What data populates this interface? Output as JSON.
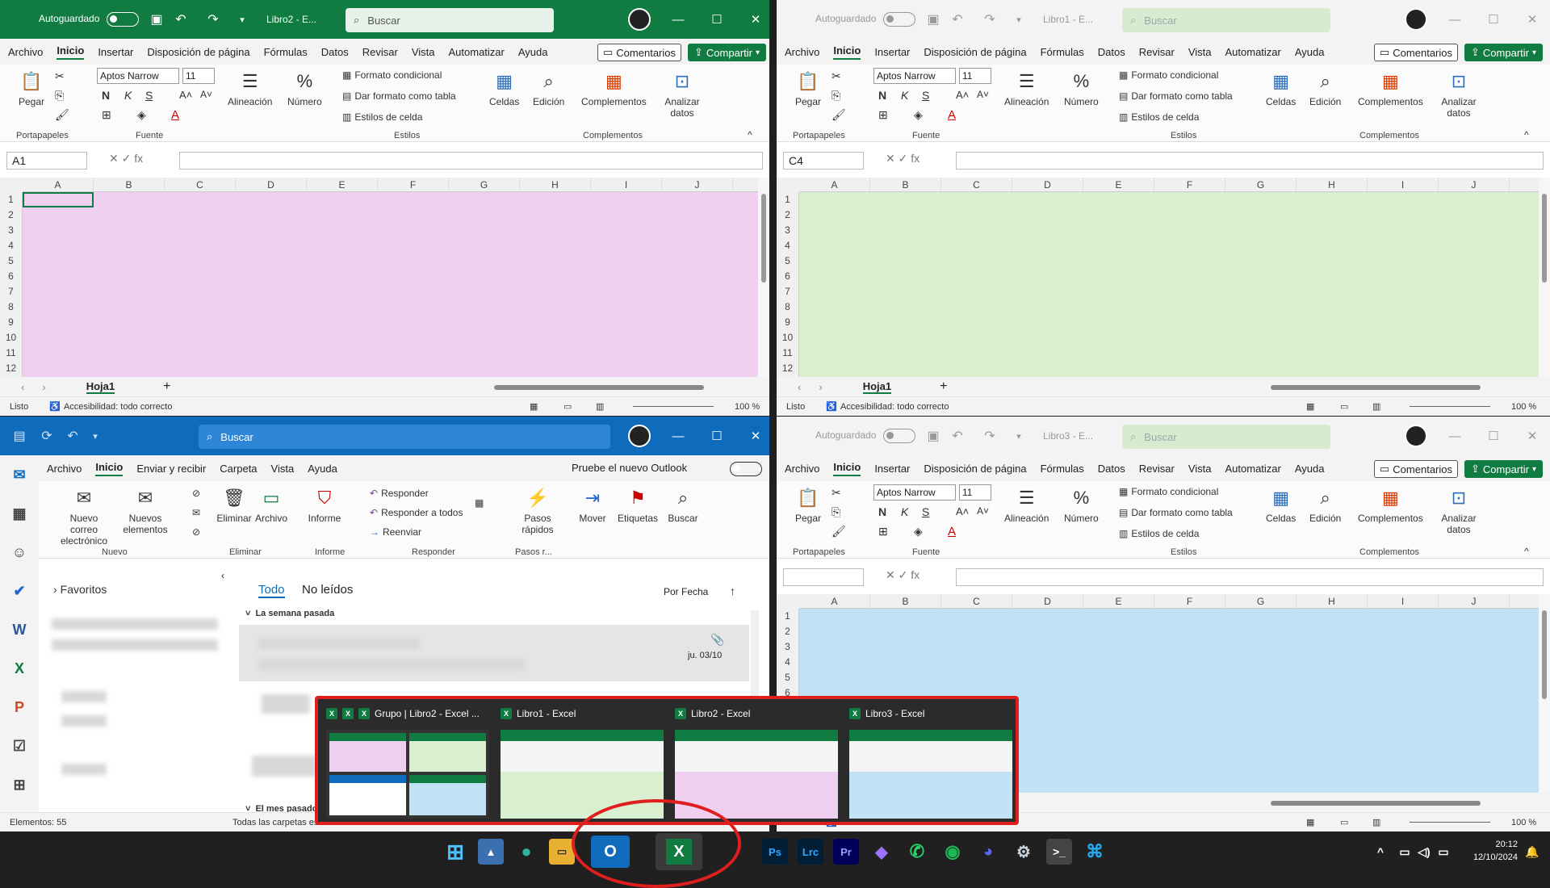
{
  "excel_common": {
    "autosave_label": "Autoguardado",
    "search_placeholder": "Buscar",
    "menu": [
      "Archivo",
      "Inicio",
      "Insertar",
      "Disposición de página",
      "Fórmulas",
      "Datos",
      "Revisar",
      "Vista",
      "Automatizar",
      "Ayuda"
    ],
    "comments_label": "Comentarios",
    "share_label": "Compartir",
    "paste_label": "Pegar",
    "font_name": "Aptos Narrow",
    "font_size": "11",
    "alignment_label": "Alineación",
    "number_label": "Número",
    "cond_format_label": "Formato condicional",
    "table_format_label": "Dar formato como tabla",
    "cell_styles_label": "Estilos de celda",
    "cells_label": "Celdas",
    "editing_label": "Edición",
    "addins_label": "Complementos",
    "analyze_label": "Analizar datos",
    "group_clipboard": "Portapapeles",
    "group_font": "Fuente",
    "group_styles": "Estilos",
    "group_addins": "Complementos",
    "columns": [
      "A",
      "B",
      "C",
      "D",
      "E",
      "F",
      "G",
      "H",
      "I",
      "J"
    ],
    "rows": [
      "1",
      "2",
      "3",
      "4",
      "5",
      "6",
      "7",
      "8",
      "9",
      "10",
      "11",
      "12"
    ],
    "sheet_tab": "Hoja1",
    "status_ready": "Listo",
    "status_accessibility": "Accesibilidad: todo correcto",
    "zoom": "100 %",
    "bold": "N",
    "italic": "K",
    "underline": "S"
  },
  "win_libro2": {
    "title": "Libro2 - E...",
    "namebox": "A1",
    "fill": "#f0d0f0"
  },
  "win_libro1": {
    "title": "Libro1 - E...",
    "namebox": "C4",
    "fill": "#d8f0d0"
  },
  "win_libro3": {
    "title": "Libro3 - E...",
    "namebox": "",
    "fill": "#c0e2f4"
  },
  "outlook": {
    "search_placeholder": "Buscar",
    "menu": [
      "Archivo",
      "Inicio",
      "Enviar y recibir",
      "Carpeta",
      "Vista",
      "Ayuda"
    ],
    "try_new": "Pruebe el nuevo Outlook",
    "new_mail": "Nuevo correo electrónico",
    "new_items": "Nuevos elementos",
    "delete": "Eliminar",
    "archive": "Archivo",
    "report": "Informe",
    "reply": "Responder",
    "reply_all": "Responder a todos",
    "forward": "Reenviar",
    "quick_steps": "Pasos rápidos",
    "move": "Mover",
    "tags": "Etiquetas",
    "find": "Buscar",
    "group_new": "Nuevo",
    "group_delete": "Eliminar",
    "group_report": "Informe",
    "group_respond": "Responder",
    "group_quick": "Pasos r...",
    "favorites": "Favoritos",
    "tab_all": "Todo",
    "tab_unread": "No leídos",
    "sort": "Por Fecha",
    "section_last_week": "La semana pasada",
    "section_last_month": "El mes pasado",
    "mail_date": "ju. 03/10",
    "status_items": "Elementos: 55",
    "status_folders": "Todas las carpetas están actualizadas."
  },
  "taskbar_preview": [
    {
      "title": "Grupo | Libro2 - Excel ..."
    },
    {
      "title": "Libro1 - Excel"
    },
    {
      "title": "Libro2 - Excel"
    },
    {
      "title": "Libro3 - Excel"
    }
  ],
  "tray": {
    "time": "20:12",
    "date": "12/10/2024"
  },
  "taskbar_icons": [
    "windows-start",
    "photos",
    "teams-people",
    "file-explorer",
    "outlook",
    "excel",
    "photoshop",
    "lightroom-classic",
    "premiere",
    "app-purple",
    "whatsapp",
    "spotify",
    "discord",
    "steam",
    "terminal",
    "vscode"
  ]
}
